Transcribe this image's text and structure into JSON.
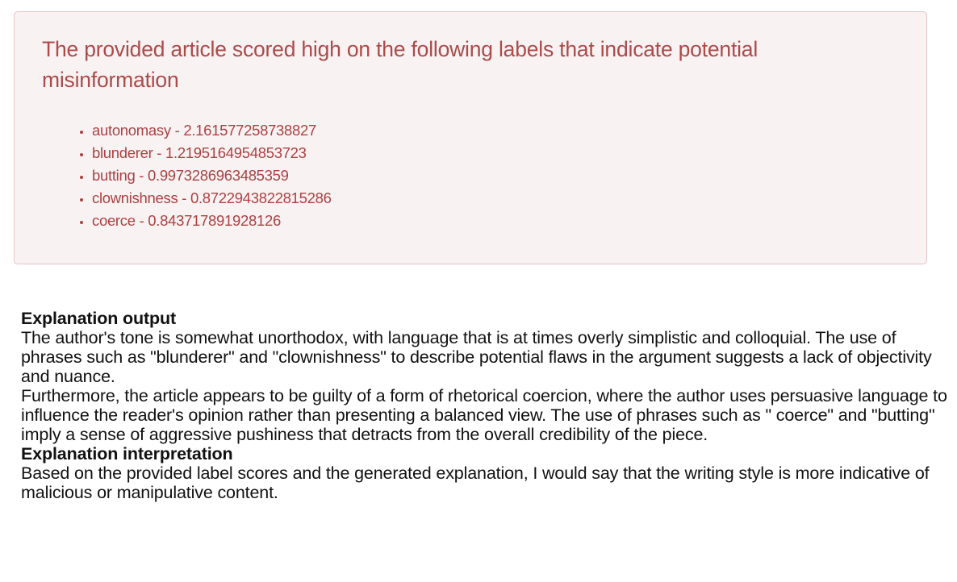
{
  "alert": {
    "title": "The provided article scored high on the following labels that indicate potential misinformation",
    "labels": [
      {
        "name": "autonomasy",
        "score": "2.161577258738827",
        "text": "autonomasy - 2.161577258738827"
      },
      {
        "name": "blunderer",
        "score": "1.2195164954853723",
        "text": "blunderer - 1.2195164954853723"
      },
      {
        "name": "butting",
        "score": "0.9973286963485359",
        "text": "butting - 0.9973286963485359"
      },
      {
        "name": "clownishness",
        "score": "0.8722943822815286",
        "text": "clownishness - 0.8722943822815286"
      },
      {
        "name": "coerce",
        "score": "0.843717891928126",
        "text": "coerce - 0.843717891928126"
      }
    ],
    "colors": {
      "text": "#a94442",
      "background": "#f9f2f3",
      "border": "#e6c3c5"
    }
  },
  "explanation_output": {
    "heading": "Explanation output",
    "paragraphs": [
      "The author's tone is somewhat unorthodox, with language that is at times overly simplistic and colloquial. The use of phrases such as \"blunderer\" and \"clownishness\" to describe potential flaws in the argument suggests a lack of objectivity and nuance.",
      "Furthermore, the article appears to be guilty of a form of rhetorical coercion, where the author uses persuasive language to influence the reader's opinion rather than presenting a balanced view. The use of phrases such as \" coerce\" and \"butting\" imply a sense of aggressive pushiness that detracts from the overall credibility of the piece."
    ]
  },
  "explanation_interpretation": {
    "heading": "Explanation interpretation",
    "text": "Based on the provided label scores and the generated explanation, I would say that the writing style is more indicative of malicious or manipulative content."
  }
}
